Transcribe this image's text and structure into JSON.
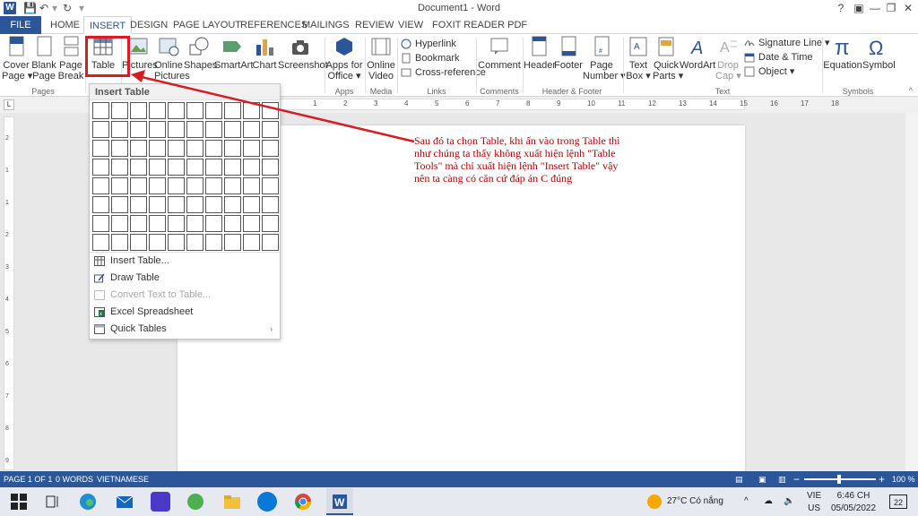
{
  "window": {
    "title": "Document1 - Word",
    "app_icon": "W",
    "controls": {
      "help": "?",
      "minimize": "—",
      "restore": "❐",
      "close": "✕"
    }
  },
  "tabs": [
    "FILE",
    "HOME",
    "INSERT",
    "DESIGN",
    "PAGE LAYOUT",
    "REFERENCES",
    "MAILINGS",
    "REVIEW",
    "VIEW",
    "FOXIT READER PDF"
  ],
  "active_tab": "INSERT",
  "ribbon": {
    "pages": {
      "cover": "Cover\nPage ▾",
      "blank": "Blank\nPage",
      "break": "Page\nBreak",
      "label": "Pages"
    },
    "tables": {
      "table": "Table",
      "label": "Tables"
    },
    "illustrations": {
      "pictures": "Pictures",
      "online_pictures": "Online\nPictures",
      "shapes": "Shapes",
      "smartart": "SmartArt",
      "chart": "Chart",
      "screenshot": "Screenshot"
    },
    "apps": {
      "apps_office": "Apps for\nOffice ▾",
      "label": "Apps"
    },
    "media": {
      "online_video": "Online\nVideo",
      "label": "Media"
    },
    "links": {
      "hyperlink": "Hyperlink",
      "bookmark": "Bookmark",
      "cross_reference": "Cross-reference",
      "label": "Links"
    },
    "comments": {
      "comment": "Comment",
      "label": "Comments"
    },
    "header_footer": {
      "header": "Header",
      "footer": "Footer",
      "page_number": "Page\nNumber ▾",
      "label": "Header & Footer"
    },
    "text": {
      "text_box": "Text\nBox ▾",
      "quick_parts": "Quick\nParts ▾",
      "wordart": "WordArt",
      "drop_cap": "Drop\nCap ▾",
      "signature_line": "Signature Line ▾",
      "date_time": "Date & Time",
      "object": "Object ▾",
      "label": "Text"
    },
    "symbols": {
      "equation": "Equation",
      "symbol": "Symbol",
      "label": "Symbols"
    }
  },
  "insert_table_menu": {
    "header": "Insert Table",
    "items": [
      {
        "label": "Insert Table...",
        "enabled": true
      },
      {
        "label": "Draw Table",
        "enabled": true
      },
      {
        "label": "Convert Text to Table...",
        "enabled": false
      },
      {
        "label": "Excel Spreadsheet",
        "enabled": true
      },
      {
        "label": "Quick Tables",
        "enabled": true,
        "submenu": "›"
      }
    ],
    "grid_cols": 10,
    "grid_rows": 8
  },
  "annotation": {
    "text": " Sau đó ta chọn Table, khi ấn vào trong Table thì như chúng ta thấy không xuất hiện lệnh \"Table Tools\" mà chỉ xuất hiện lệnh \"Insert Table\" vậy nên ta càng có căn cứ đáp án C đúng",
    "color": "#c00000"
  },
  "ruler": {
    "marks": [
      "1",
      "2",
      "3",
      "4",
      "5",
      "6",
      "7",
      "8",
      "9",
      "10",
      "11",
      "12",
      "13",
      "14",
      "15",
      "16",
      "17",
      "18"
    ],
    "vmarks": [
      "2",
      "1",
      "1",
      "2",
      "3",
      "4",
      "5",
      "6",
      "7",
      "8",
      "9",
      "10"
    ]
  },
  "statusbar": {
    "page": "PAGE 1 OF 1",
    "words": "0 WORDS",
    "language": "VIETNAMESE",
    "zoom": "100 %",
    "zoom_minus": "−",
    "zoom_plus": "+"
  },
  "taskbar": {
    "weather": "27°C  Có nắng",
    "lang_top": "VIE",
    "lang_bottom": "US",
    "time": "6:46 CH",
    "date": "05/05/2022",
    "notifications": "22"
  },
  "colors": {
    "word_blue": "#2b579a",
    "highlight_red": "#d71d21",
    "annotation_red": "#c00000"
  }
}
